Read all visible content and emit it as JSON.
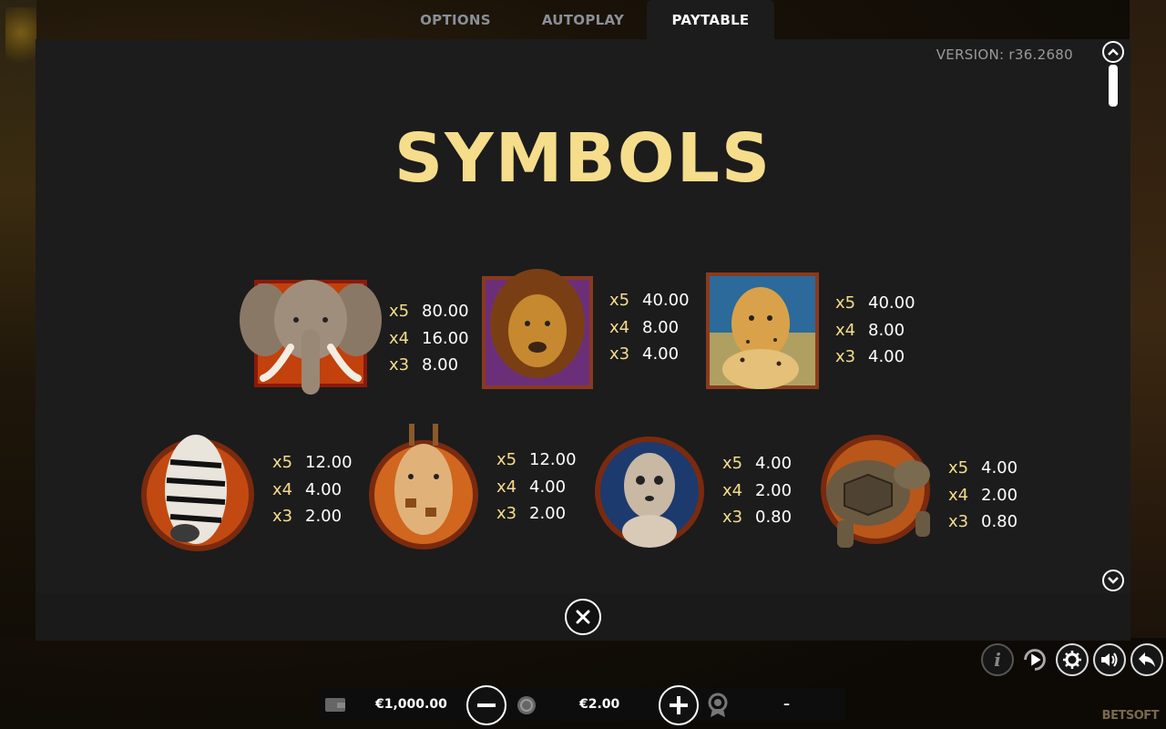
{
  "tabs": [
    {
      "label": "OPTIONS"
    },
    {
      "label": "AUTOPLAY"
    },
    {
      "label": "PAYTABLE"
    }
  ],
  "version": "VERSION: r36.2680",
  "title": "SYMBOLS",
  "symbols": [
    {
      "icon": "elephant-icon",
      "pays": [
        {
          "m": "x5",
          "v": "80.00"
        },
        {
          "m": "x4",
          "v": "16.00"
        },
        {
          "m": "x3",
          "v": "8.00"
        }
      ]
    },
    {
      "icon": "lion-icon",
      "pays": [
        {
          "m": "x5",
          "v": "40.00"
        },
        {
          "m": "x4",
          "v": "8.00"
        },
        {
          "m": "x3",
          "v": "4.00"
        }
      ]
    },
    {
      "icon": "cheetah-icon",
      "pays": [
        {
          "m": "x5",
          "v": "40.00"
        },
        {
          "m": "x4",
          "v": "8.00"
        },
        {
          "m": "x3",
          "v": "4.00"
        }
      ]
    },
    {
      "icon": "zebra-icon",
      "pays": [
        {
          "m": "x5",
          "v": "12.00"
        },
        {
          "m": "x4",
          "v": "4.00"
        },
        {
          "m": "x3",
          "v": "2.00"
        }
      ]
    },
    {
      "icon": "giraffe-icon",
      "pays": [
        {
          "m": "x5",
          "v": "12.00"
        },
        {
          "m": "x4",
          "v": "4.00"
        },
        {
          "m": "x3",
          "v": "2.00"
        }
      ]
    },
    {
      "icon": "meerkat-icon",
      "pays": [
        {
          "m": "x5",
          "v": "4.00"
        },
        {
          "m": "x4",
          "v": "2.00"
        },
        {
          "m": "x3",
          "v": "0.80"
        }
      ]
    },
    {
      "icon": "tortoise-icon",
      "pays": [
        {
          "m": "x5",
          "v": "4.00"
        },
        {
          "m": "x4",
          "v": "2.00"
        },
        {
          "m": "x3",
          "v": "0.80"
        }
      ]
    }
  ],
  "bottom": {
    "balance": "€1,000.00",
    "bet": "€2.00",
    "win": "–"
  },
  "brand": "BETSOFT",
  "colors": {
    "accent": "#f6dd8c",
    "panel": "#1c1c1c"
  }
}
